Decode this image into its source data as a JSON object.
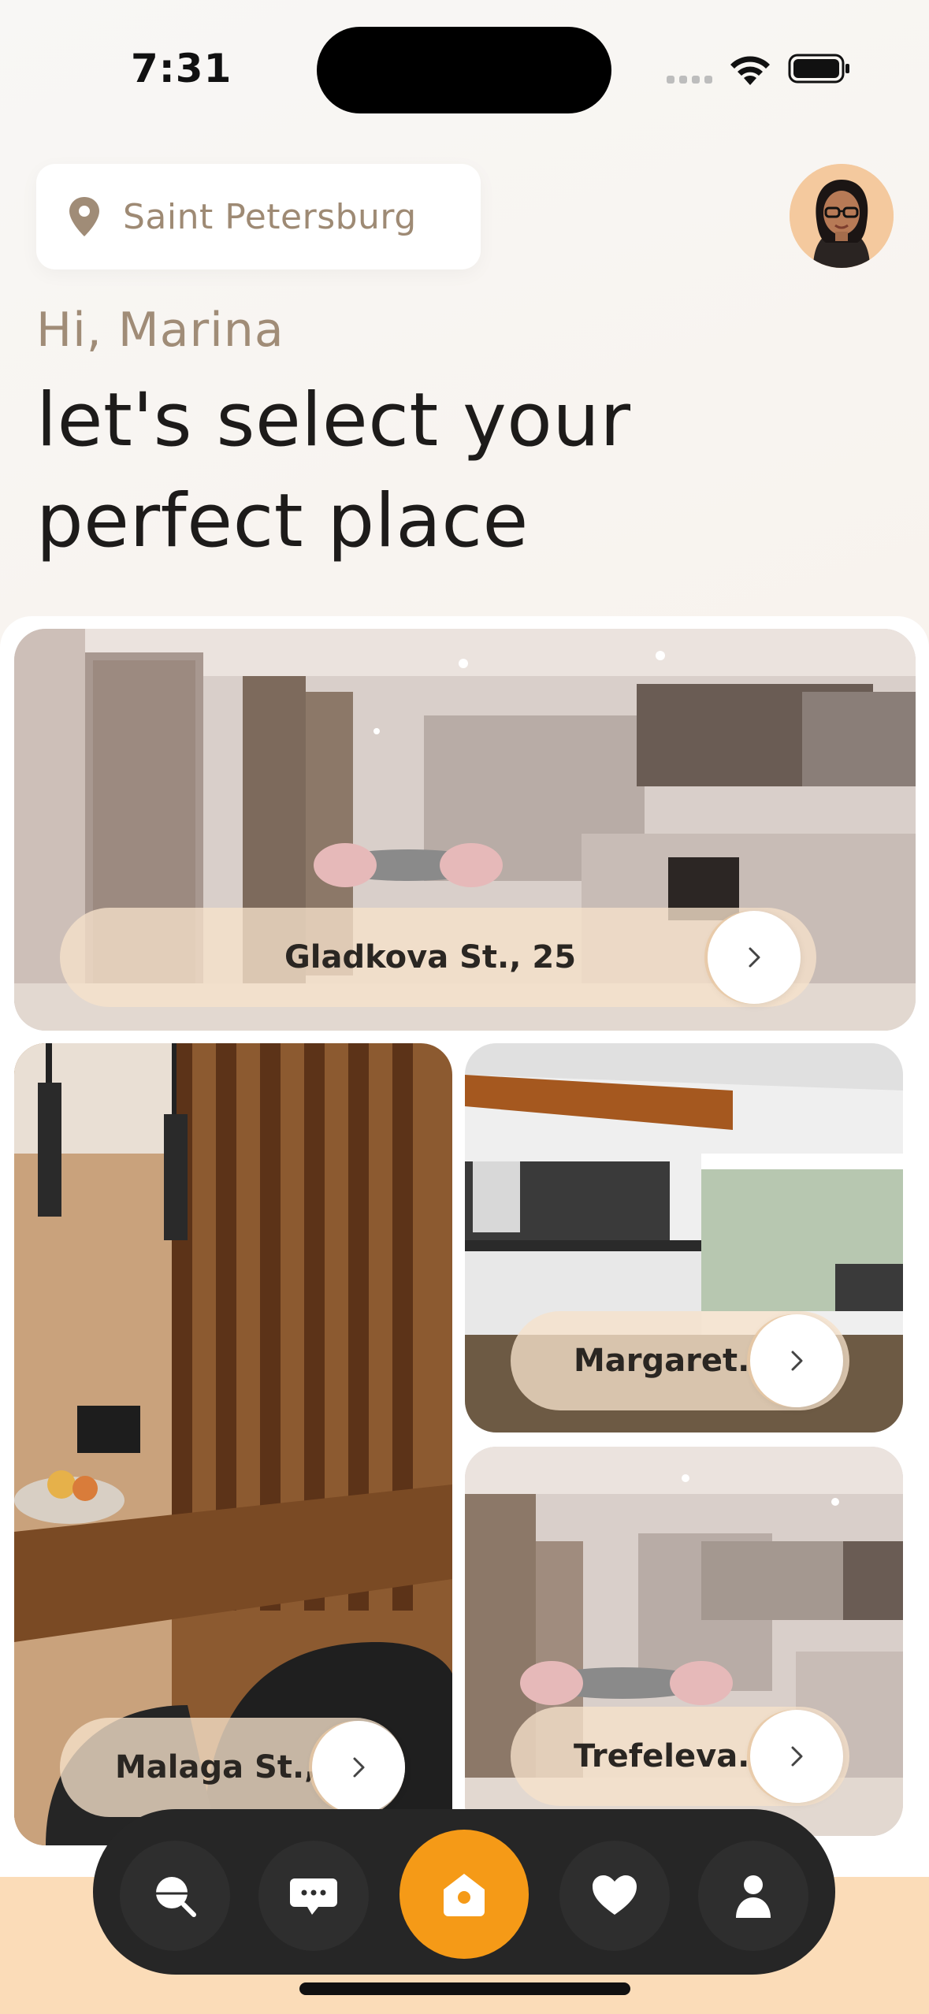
{
  "status_bar": {
    "time": "7:31"
  },
  "header": {
    "location": "Saint Petersburg",
    "greeting": "Hi, Marina",
    "headline_line1": "let's select your",
    "headline_line2": "perfect place"
  },
  "listings": [
    {
      "label": "Gladkova St., 25"
    },
    {
      "label": "Malaga St., 14"
    },
    {
      "label": "Margaret., 5"
    },
    {
      "label": "Trefeleva., 4"
    }
  ],
  "nav": {
    "items": [
      {
        "icon": "search-icon"
      },
      {
        "icon": "chat-icon"
      },
      {
        "icon": "home-icon",
        "active": true
      },
      {
        "icon": "heart-icon"
      },
      {
        "icon": "profile-icon"
      }
    ],
    "accent": "#f59a17"
  },
  "colors": {
    "accent": "#f59a17",
    "pill": "#f6e2cb",
    "nav_bg": "#262626"
  }
}
